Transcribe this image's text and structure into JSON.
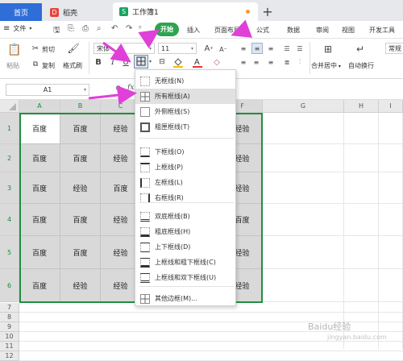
{
  "tabs": {
    "home": "首页",
    "doc": "稻壳",
    "doc_icon": "D",
    "workbook": "工作簿1",
    "workbook_icon": "S",
    "add": "+"
  },
  "menu": {
    "file": "文件",
    "start": "开始",
    "items": [
      "插入",
      "页面布局",
      "公式",
      "数据",
      "审阅",
      "视图",
      "开发工具"
    ]
  },
  "ribbon": {
    "paste": "粘贴",
    "cut": "剪切",
    "copy": "复制",
    "format_painter": "格式刷",
    "font_name": "宋体",
    "font_size": "11",
    "bold": "B",
    "italic": "I",
    "underline": "U",
    "grow_font": "A",
    "shrink_font": "A",
    "merge_center": "合并居中",
    "auto_wrap": "自动换行",
    "number_format": "常规"
  },
  "formula_bar": {
    "name_box": "A1",
    "fx": "fx"
  },
  "columns": [
    "A",
    "B",
    "C",
    "D",
    "E",
    "F",
    "G",
    "H",
    "I"
  ],
  "rows": [
    "1",
    "2",
    "3",
    "4",
    "5",
    "6",
    "7",
    "8",
    "9",
    "10",
    "11",
    "12"
  ],
  "cells": [
    [
      "百度",
      "百度",
      "经验",
      "",
      "",
      "经验"
    ],
    [
      "百度",
      "百度",
      "经验",
      "",
      "",
      "经验"
    ],
    [
      "百度",
      "经验",
      "百度",
      "",
      "",
      "经验"
    ],
    [
      "百度",
      "百度",
      "经验",
      "",
      "",
      "百度"
    ],
    [
      "百度",
      "百度",
      "经验",
      "",
      "",
      "经验"
    ],
    [
      "百度",
      "经验",
      "经验",
      "",
      "",
      "经验"
    ]
  ],
  "border_menu": {
    "items": [
      "无框线(N)",
      "所有框线(A)",
      "外侧框线(S)",
      "粗匣框线(T)",
      "下框线(O)",
      "上框线(P)",
      "左框线(L)",
      "右框线(R)",
      "双底框线(B)",
      "粗底框线(H)",
      "上下框线(D)",
      "上框线和粗下框线(C)",
      "上框线和双下框线(U)",
      "其他边框(M)..."
    ],
    "highlighted_index": 1
  },
  "watermark": {
    "brand": "Baidu经验",
    "url": "jingyan.baidu.com"
  },
  "colors": {
    "accent_green": "#2ea44f",
    "arrow_magenta": "#e040d8",
    "home_tab_blue": "#2f6dd8"
  }
}
